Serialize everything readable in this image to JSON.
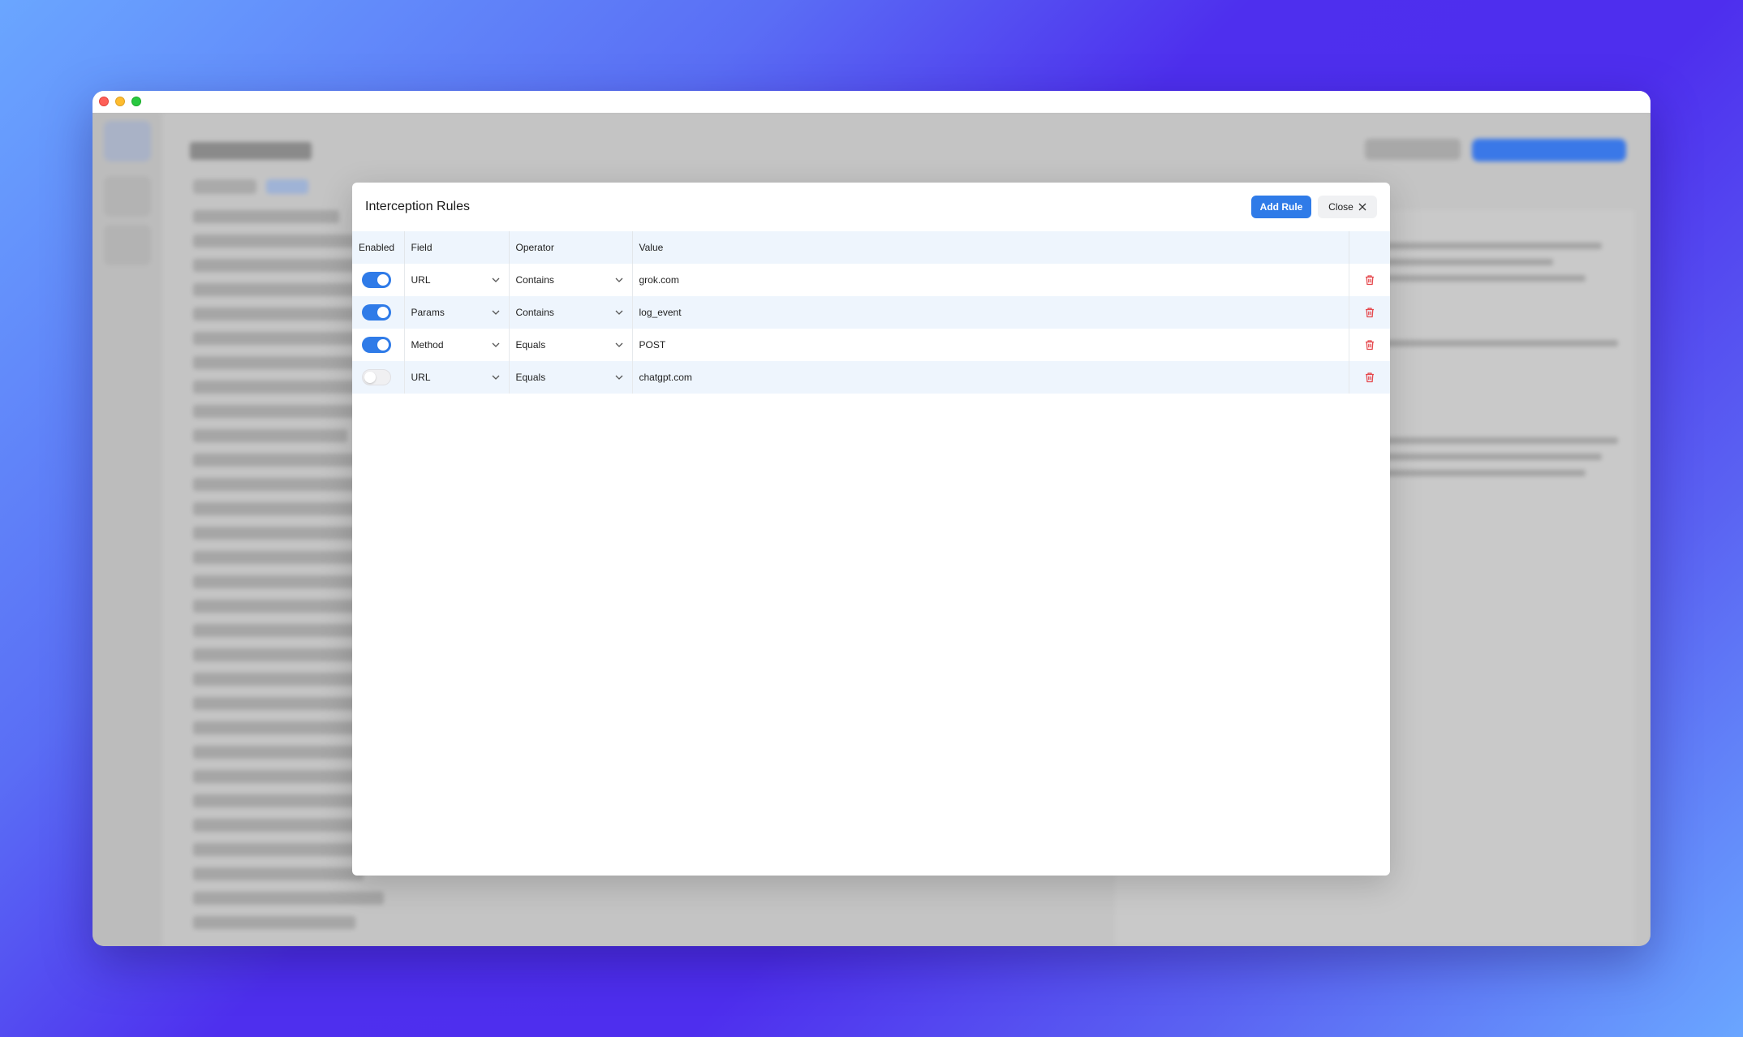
{
  "modal": {
    "title": "Interception Rules",
    "add_rule_label": "Add Rule",
    "close_label": "Close"
  },
  "table": {
    "headers": {
      "enabled": "Enabled",
      "field": "Field",
      "operator": "Operator",
      "value": "Value"
    },
    "rows": [
      {
        "enabled": true,
        "field": "URL",
        "operator": "Contains",
        "value": "grok.com"
      },
      {
        "enabled": true,
        "field": "Params",
        "operator": "Contains",
        "value": "log_event"
      },
      {
        "enabled": true,
        "field": "Method",
        "operator": "Equals",
        "value": "POST"
      },
      {
        "enabled": false,
        "field": "URL",
        "operator": "Equals",
        "value": "chatgpt.com"
      }
    ]
  },
  "colors": {
    "accent": "#2f7be8",
    "delete": "#e5484d",
    "header_bg": "#eef5fd"
  },
  "icons": [
    "chevron-down-icon",
    "trash-icon",
    "close-icon"
  ]
}
